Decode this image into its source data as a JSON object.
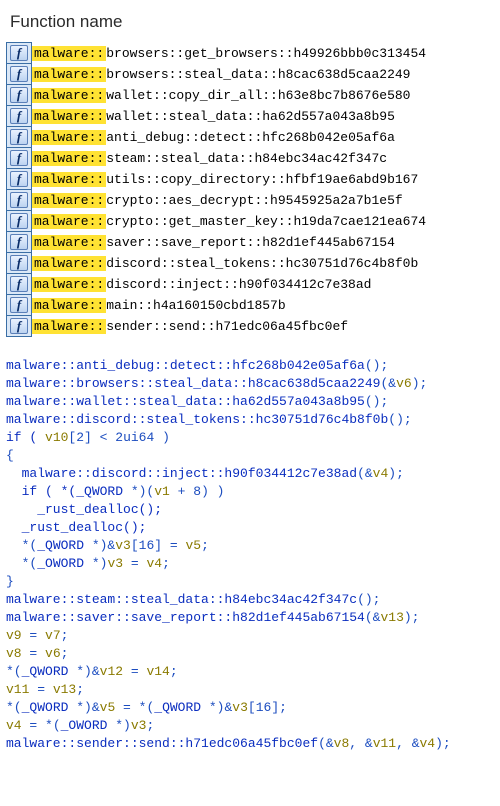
{
  "header": "Function name",
  "icon_glyph": "f",
  "functions": [
    {
      "hi": "malware::",
      "mid": "browsers::get_browsers::",
      "hash": "h49926bbb0c313454"
    },
    {
      "hi": "malware::",
      "mid": "browsers::steal_data::",
      "hash": "h8cac638d5caa2249"
    },
    {
      "hi": "malware::",
      "mid": "wallet::copy_dir_all::",
      "hash": "h63e8bc7b8676e580"
    },
    {
      "hi": "malware::",
      "mid": "wallet::steal_data::",
      "hash": "ha62d557a043a8b95"
    },
    {
      "hi": "malware::",
      "mid": "anti_debug::detect::",
      "hash": "hfc268b042e05af6a"
    },
    {
      "hi": "malware::",
      "mid": "steam::steal_data::",
      "hash": "h84ebc34ac42f347c"
    },
    {
      "hi": "malware::",
      "mid": "utils::copy_directory::",
      "hash": "hfbf19ae6abd9b167"
    },
    {
      "hi": "malware::",
      "mid": "crypto::aes_decrypt::",
      "hash": "h9545925a2a7b1e5f"
    },
    {
      "hi": "malware::",
      "mid": "crypto::get_master_key::",
      "hash": "h19da7cae121ea674"
    },
    {
      "hi": "malware::",
      "mid": "saver::save_report::",
      "hash": "h82d1ef445ab67154"
    },
    {
      "hi": "malware::",
      "mid": "discord::steal_tokens::",
      "hash": "hc30751d76c4b8f0b"
    },
    {
      "hi": "malware::",
      "mid": "discord::inject::",
      "hash": "h90f034412c7e38ad"
    },
    {
      "hi": "malware::",
      "mid": "main::",
      "hash": "h4a160150cbd1857b"
    },
    {
      "hi": "malware::",
      "mid": "sender::send::",
      "hash": "h71edc06a45fbc0ef"
    }
  ],
  "code_lines": [
    [
      {
        "t": "malware::anti_debug::detect::hfc268b042e05af6a",
        "c": "kw"
      },
      {
        "t": "();",
        "c": "paren"
      }
    ],
    [
      {
        "t": "malware::browsers::steal_data::h8cac638d5caa2249",
        "c": "kw"
      },
      {
        "t": "(&",
        "c": "paren"
      },
      {
        "t": "v6",
        "c": "var"
      },
      {
        "t": ");",
        "c": "paren"
      }
    ],
    [
      {
        "t": "malware::wallet::steal_data::ha62d557a043a8b95",
        "c": "kw"
      },
      {
        "t": "();",
        "c": "paren"
      }
    ],
    [
      {
        "t": "malware::discord::steal_tokens::hc30751d76c4b8f0b",
        "c": "kw"
      },
      {
        "t": "();",
        "c": "paren"
      }
    ],
    [
      {
        "t": "if ( ",
        "c": "kw"
      },
      {
        "t": "v10",
        "c": "var"
      },
      {
        "t": "[",
        "c": "paren"
      },
      {
        "t": "2",
        "c": "num"
      },
      {
        "t": "] < ",
        "c": "paren"
      },
      {
        "t": "2ui64",
        "c": "num"
      },
      {
        "t": " )",
        "c": "paren"
      }
    ],
    [
      {
        "t": "{",
        "c": "paren"
      }
    ],
    [
      {
        "t": "  malware::discord::inject::h90f034412c7e38ad",
        "c": "kw"
      },
      {
        "t": "(&",
        "c": "paren"
      },
      {
        "t": "v4",
        "c": "var"
      },
      {
        "t": ");",
        "c": "paren"
      }
    ],
    [
      {
        "t": "  if ( *(",
        "c": "kw"
      },
      {
        "t": "_QWORD",
        "c": "kw"
      },
      {
        "t": " *)(",
        "c": "paren"
      },
      {
        "t": "v1",
        "c": "var"
      },
      {
        "t": " + ",
        "c": "paren"
      },
      {
        "t": "8",
        "c": "num"
      },
      {
        "t": ") )",
        "c": "paren"
      }
    ],
    [
      {
        "t": "    _rust_dealloc();",
        "c": "kw"
      }
    ],
    [
      {
        "t": "  _rust_dealloc();",
        "c": "kw"
      }
    ],
    [
      {
        "t": "  *(",
        "c": "paren"
      },
      {
        "t": "_QWORD",
        "c": "kw"
      },
      {
        "t": " *)&",
        "c": "paren"
      },
      {
        "t": "v3",
        "c": "var"
      },
      {
        "t": "[",
        "c": "paren"
      },
      {
        "t": "16",
        "c": "num"
      },
      {
        "t": "] = ",
        "c": "paren"
      },
      {
        "t": "v5",
        "c": "var"
      },
      {
        "t": ";",
        "c": "paren"
      }
    ],
    [
      {
        "t": "  *(",
        "c": "paren"
      },
      {
        "t": "_OWORD",
        "c": "kw"
      },
      {
        "t": " *)",
        "c": "paren"
      },
      {
        "t": "v3",
        "c": "var"
      },
      {
        "t": " = ",
        "c": "paren"
      },
      {
        "t": "v4",
        "c": "var"
      },
      {
        "t": ";",
        "c": "paren"
      }
    ],
    [
      {
        "t": "}",
        "c": "paren"
      }
    ],
    [
      {
        "t": "malware::steam::steal_data::h84ebc34ac42f347c",
        "c": "kw"
      },
      {
        "t": "();",
        "c": "paren"
      }
    ],
    [
      {
        "t": "malware::saver::save_report::h82d1ef445ab67154",
        "c": "kw"
      },
      {
        "t": "(&",
        "c": "paren"
      },
      {
        "t": "v13",
        "c": "var"
      },
      {
        "t": ");",
        "c": "paren"
      }
    ],
    [
      {
        "t": "v9",
        "c": "var"
      },
      {
        "t": " = ",
        "c": "paren"
      },
      {
        "t": "v7",
        "c": "var"
      },
      {
        "t": ";",
        "c": "paren"
      }
    ],
    [
      {
        "t": "v8",
        "c": "var"
      },
      {
        "t": " = ",
        "c": "paren"
      },
      {
        "t": "v6",
        "c": "var"
      },
      {
        "t": ";",
        "c": "paren"
      }
    ],
    [
      {
        "t": "*(",
        "c": "paren"
      },
      {
        "t": "_QWORD",
        "c": "kw"
      },
      {
        "t": " *)&",
        "c": "paren"
      },
      {
        "t": "v12",
        "c": "var"
      },
      {
        "t": " = ",
        "c": "paren"
      },
      {
        "t": "v14",
        "c": "var"
      },
      {
        "t": ";",
        "c": "paren"
      }
    ],
    [
      {
        "t": "v11",
        "c": "var"
      },
      {
        "t": " = ",
        "c": "paren"
      },
      {
        "t": "v13",
        "c": "var"
      },
      {
        "t": ";",
        "c": "paren"
      }
    ],
    [
      {
        "t": "*(",
        "c": "paren"
      },
      {
        "t": "_QWORD",
        "c": "kw"
      },
      {
        "t": " *)&",
        "c": "paren"
      },
      {
        "t": "v5",
        "c": "var"
      },
      {
        "t": " = *(",
        "c": "paren"
      },
      {
        "t": "_QWORD",
        "c": "kw"
      },
      {
        "t": " *)&",
        "c": "paren"
      },
      {
        "t": "v3",
        "c": "var"
      },
      {
        "t": "[",
        "c": "paren"
      },
      {
        "t": "16",
        "c": "num"
      },
      {
        "t": "];",
        "c": "paren"
      }
    ],
    [
      {
        "t": "v4",
        "c": "var"
      },
      {
        "t": " = *(",
        "c": "paren"
      },
      {
        "t": "_OWORD",
        "c": "kw"
      },
      {
        "t": " *)",
        "c": "paren"
      },
      {
        "t": "v3",
        "c": "var"
      },
      {
        "t": ";",
        "c": "paren"
      }
    ],
    [
      {
        "t": "malware::sender::send::h71edc06a45fbc0ef",
        "c": "kw"
      },
      {
        "t": "(&",
        "c": "paren"
      },
      {
        "t": "v8",
        "c": "var"
      },
      {
        "t": ", &",
        "c": "paren"
      },
      {
        "t": "v11",
        "c": "var"
      },
      {
        "t": ", &",
        "c": "paren"
      },
      {
        "t": "v4",
        "c": "var"
      },
      {
        "t": ");",
        "c": "paren"
      }
    ]
  ]
}
